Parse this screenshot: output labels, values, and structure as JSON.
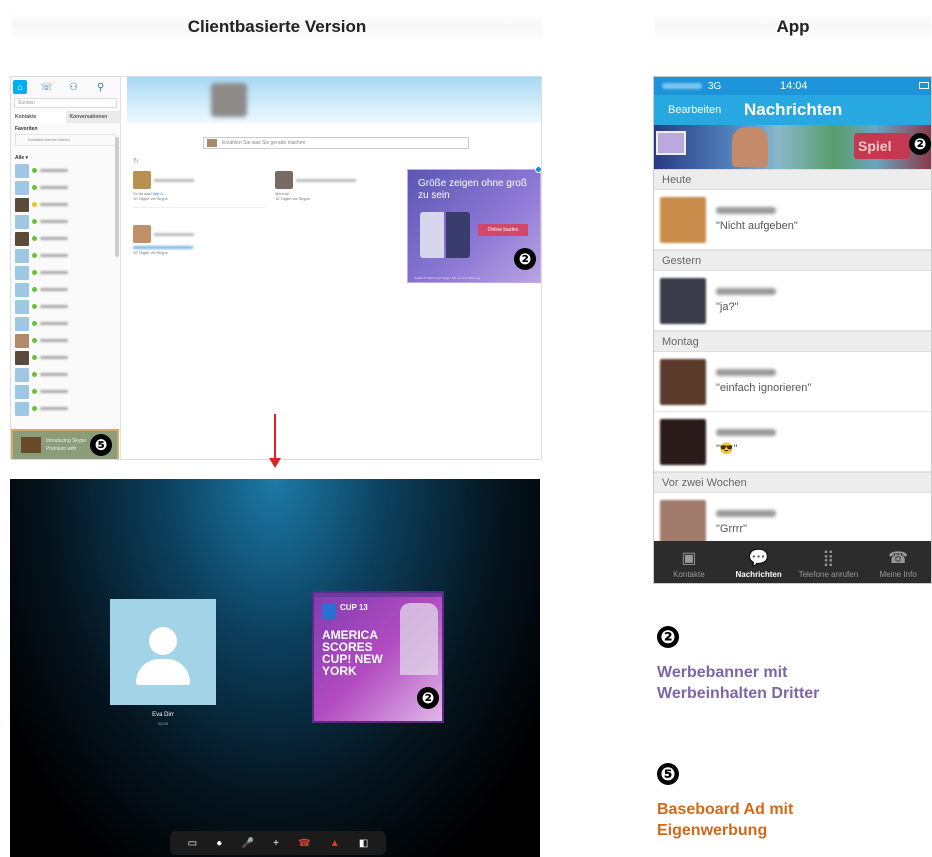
{
  "headers": {
    "left": "Clientbasierte Version",
    "right": "App"
  },
  "desktop": {
    "search_placeholder": "Suchen",
    "tabs": [
      "Kontakte",
      "Konversationen"
    ],
    "favorites_label": "Favoriten",
    "favorites_hint": "Kontakte hierhin ziehen",
    "all_label": "Alle ▾",
    "status_placeholder": "Erzählen Sie was Sie gerade machen",
    "cards": [
      {
        "line1": "So ist das!",
        "line2": "10 Tagen via Skype"
      },
      {
        "line1": "@home",
        "line2": "10 Tagen via Skype"
      },
      {
        "line1": "",
        "line2": "10 Tagen via Skype"
      }
    ],
    "ad": {
      "text": "Größe zeigen ohne groß zu sein",
      "button": "Online kaufen",
      "footer": "Gefällt dir Werbung? Sagen Sie uns Ihre Meinung",
      "badge": "❷"
    },
    "baseboard": {
      "text": "Introducing Skype Premium with",
      "badge": "❺"
    }
  },
  "call": {
    "name": "Eva Dirr",
    "time": "00:26",
    "ad": {
      "cup": "CUP 13",
      "headline": "AMERICA SCORES CUP! NEW YORK",
      "badge": "❷"
    },
    "controls": [
      "▭",
      "●",
      "🎤",
      "+",
      "☎",
      "▲",
      "◧"
    ]
  },
  "app": {
    "status": {
      "network": "3G",
      "time": "14:04"
    },
    "nav": {
      "edit": "Bearbeiten",
      "title": "Nachrichten"
    },
    "banner": {
      "cta": "Spiel",
      "badge": "❷"
    },
    "sections": [
      {
        "label": "Heute",
        "messages": [
          {
            "text": "\"Nicht aufgeben\"",
            "color": "#c98b4a"
          }
        ]
      },
      {
        "label": "Gestern",
        "messages": [
          {
            "text": "\"ja?\"",
            "color": "#3b3b4b"
          }
        ]
      },
      {
        "label": "Montag",
        "messages": [
          {
            "text": "\"einfach ignorieren\"",
            "color": "#5a3a2a"
          },
          {
            "text": "\"😎\"",
            "color": "#2a1a1a"
          }
        ]
      },
      {
        "label": "Vor zwei Wochen",
        "messages": [
          {
            "text": "\"Grrrr\"",
            "color": "#a07a6a"
          }
        ]
      }
    ],
    "tabs": [
      {
        "label": "Kontakte",
        "icon": "contact-icon",
        "glyph": "▣",
        "active": false
      },
      {
        "label": "Nachrichten",
        "icon": "chat-icon",
        "glyph": "💬",
        "active": true
      },
      {
        "label": "Telefone anrufen",
        "icon": "dialpad-icon",
        "glyph": "⣿",
        "active": false
      },
      {
        "label": "Meine Info",
        "icon": "profile-icon",
        "glyph": "☎",
        "active": false
      }
    ]
  },
  "legend": [
    {
      "badge": "❷",
      "text": "Werbebanner mit Werbeinhalten Dritter",
      "color": "#7b67a8"
    },
    {
      "badge": "❺",
      "text": "Baseboard Ad mit Eigenwerbung",
      "color": "#d06a1a"
    }
  ]
}
